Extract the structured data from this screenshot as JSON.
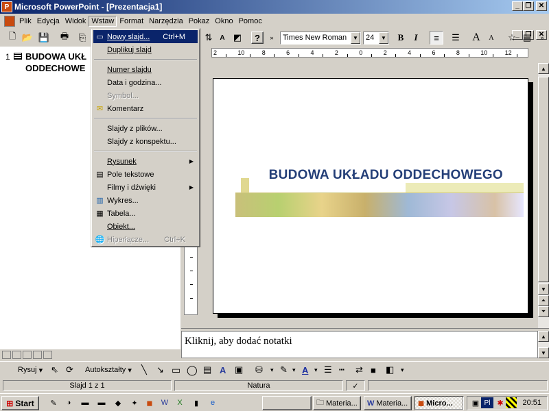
{
  "window": {
    "title": "Microsoft PowerPoint - [Prezentacja1]",
    "min_glyph": "_",
    "max_glyph": "❐",
    "close_glyph": "✕"
  },
  "menubar": {
    "items": [
      "Plik",
      "Edycja",
      "Widok",
      "Wstaw",
      "Format",
      "Narzędzia",
      "Pokaz",
      "Okno",
      "Pomoc"
    ]
  },
  "toolbar": {
    "font_name": "Times New Roman",
    "font_size": "24",
    "bold": "B",
    "italic": "I",
    "help": "?",
    "font_grow": "A",
    "font_shrink": "A"
  },
  "outline": {
    "slide_number": "1",
    "text_line1": "BUDOWA UKŁ",
    "text_line2": "ODDECHOWE"
  },
  "ruler": {
    "labels": [
      "2",
      "10",
      "8",
      "6",
      "4",
      "2",
      "0",
      "2",
      "4",
      "6",
      "8",
      "10",
      "12"
    ]
  },
  "slide": {
    "title": "BUDOWA UKŁADU ODDECHOWEGO"
  },
  "notes": {
    "placeholder": "Kliknij, aby dodać notatki"
  },
  "drawing_toolbar": {
    "draw_label": "Rysuj",
    "autoshapes_label": "Autokształty"
  },
  "statusbar": {
    "slide_info": "Slajd 1 z 1",
    "design": "Natura"
  },
  "insert_menu": {
    "items": [
      {
        "label": "Nowy slajd...",
        "shortcut": "Ctrl+M"
      },
      {
        "label": "Duplikuj slajd"
      },
      {
        "label": "Numer slajdu"
      },
      {
        "label": "Data i godzina..."
      },
      {
        "label": "Symbol..."
      },
      {
        "label": "Komentarz"
      },
      {
        "label": "Slajdy z plików..."
      },
      {
        "label": "Slajdy z konspektu..."
      },
      {
        "label": "Rysunek"
      },
      {
        "label": "Pole tekstowe"
      },
      {
        "label": "Filmy i dźwięki"
      },
      {
        "label": "Wykres..."
      },
      {
        "label": "Tabela..."
      },
      {
        "label": "Obiekt..."
      },
      {
        "label": "Hiperłącze...",
        "shortcut": "Ctrl+K"
      }
    ]
  },
  "taskbar": {
    "start_label": "Start",
    "tasks": [
      "Materia...",
      "Materia...",
      "Micro..."
    ],
    "lang": "Pl",
    "clock": "20:51"
  }
}
